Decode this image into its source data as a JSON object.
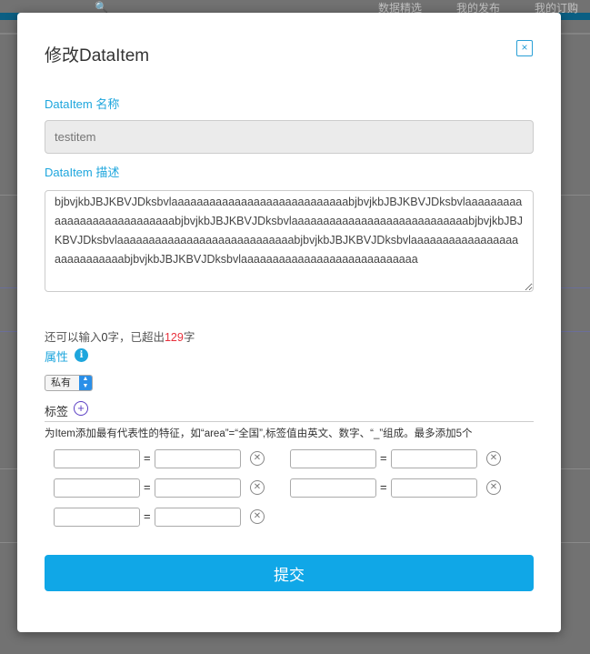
{
  "background": {
    "nav": [
      "数据精选",
      "我的发布",
      "我的订购"
    ]
  },
  "modal": {
    "title": "修改DataItem",
    "close_label": "×",
    "name_label": "DataItem 名称",
    "name_placeholder": "testitem",
    "name_value": "",
    "desc_label": "DataItem 描述",
    "desc_value": "bjbvjkbJBJKBVJDksbvlaaaaaaaaaaaaaaaaaaaaaaaaaaaabjbvjkbJBJKBVJDksbvlaaaaaaaaaaaaaaaaaaaaaaaaaaaabjbvjkbJBJKBVJDksbvlaaaaaaaaaaaaaaaaaaaaaaaaaaaabjbvjkbJBJKBVJDksbvlaaaaaaaaaaaaaaaaaaaaaaaaaaaabjbvjkbJBJKBVJDksbvlaaaaaaaaaaaaaaaaaaaaaaaaaaaabjbvjkbJBJKBVJDksbvlaaaaaaaaaaaaaaaaaaaaaaaaaaaa",
    "counter": {
      "prefix": "还可以输入",
      "remaining": "0",
      "middle": "字，已超出",
      "over": "129",
      "suffix": "字"
    },
    "attr_label": "属性",
    "attr_select": "私有",
    "tag_label": "标签",
    "tag_hint": "为Item添加最有代表性的特征，如“area”=“全国”,标签值由英文、数字、“_”组成。最多添加5个",
    "tag_eq": "=",
    "submit_label": "提交"
  }
}
